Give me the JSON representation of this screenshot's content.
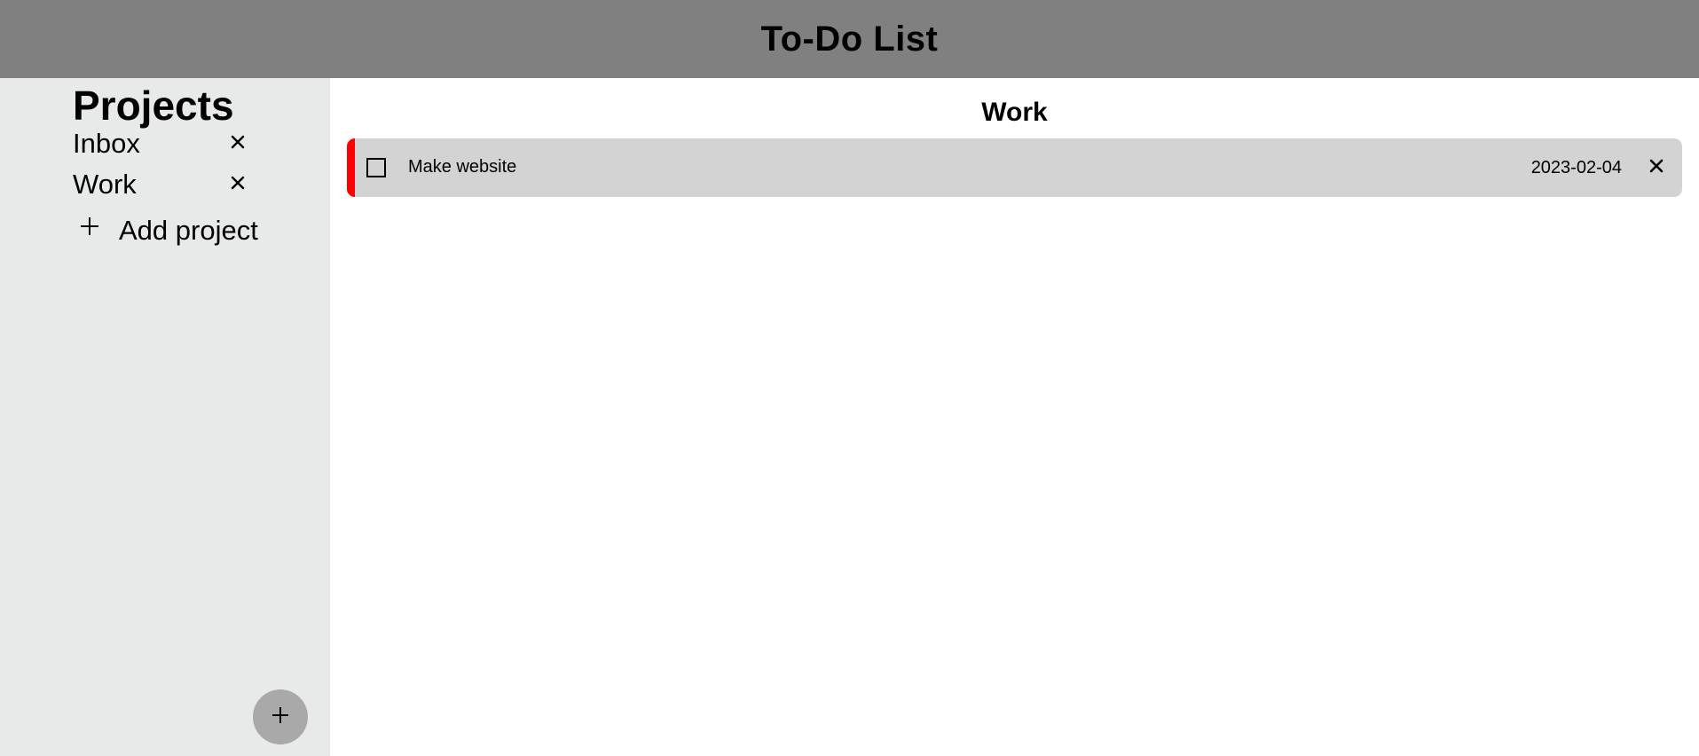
{
  "header": {
    "title": "To-Do List"
  },
  "sidebar": {
    "title": "Projects",
    "projects": [
      {
        "label": "Inbox",
        "delete_icon": "close-icon"
      },
      {
        "label": "Work",
        "delete_icon": "close-icon"
      }
    ],
    "add_project_label": "Add project",
    "add_project_icon": "plus-icon",
    "fab_icon": "plus-icon"
  },
  "main": {
    "title": "Work",
    "tasks": [
      {
        "title": "Make website",
        "due_date": "2023-02-04",
        "completed": false,
        "priority_color": "#ff0000"
      }
    ]
  },
  "colors": {
    "header_bg": "#808080",
    "sidebar_bg": "#e8eae9",
    "task_bg": "#d3d3d3",
    "fab_bg": "#a9a9a9"
  }
}
